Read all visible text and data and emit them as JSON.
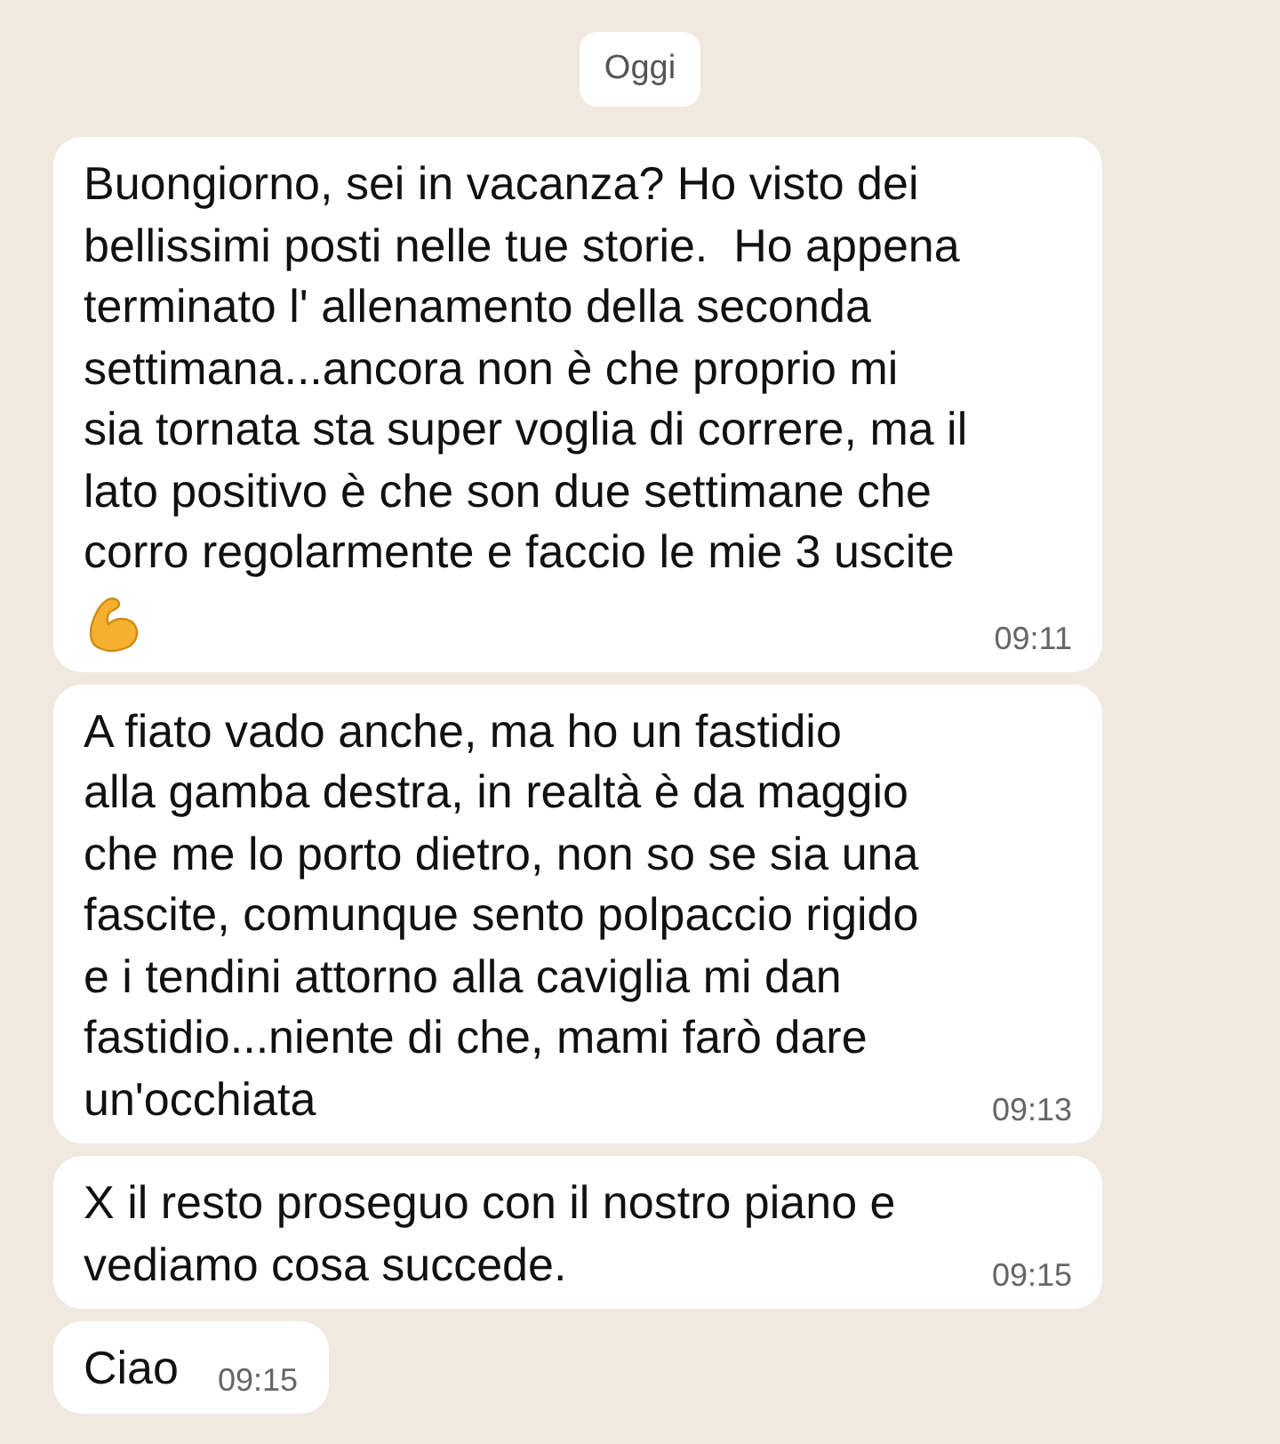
{
  "date_divider": "Oggi",
  "messages": [
    {
      "text": "Buongiorno, sei in vacanza? Ho visto dei\nbellissimi posti nelle tue storie.  Ho appena\nterminato l' allenamento della seconda\nsettimana...ancora non è che proprio mi\nsia tornata sta super voglia di correre, ma il\nlato positivo è che son due settimane che\ncorro regolarmente e faccio le mie 3 uscite",
      "kind": "text-with-emoji",
      "time": "09:11"
    },
    {
      "text": "A fiato vado anche, ma ho un fastidio\nalla gamba destra, in realtà è da maggio\nche me lo porto dietro, non so se sia una\nfascite, comunque sento polpaccio rigido\ne i tendini attorno alla caviglia mi dan\nfastidio...niente di che, mami farò dare\nun'occhiata",
      "time": "09:13"
    },
    {
      "text": "X il resto proseguo con il nostro piano e\nvediamo cosa succede.",
      "time": "09:15"
    },
    {
      "text": "Ciao",
      "time": "09:15"
    }
  ]
}
